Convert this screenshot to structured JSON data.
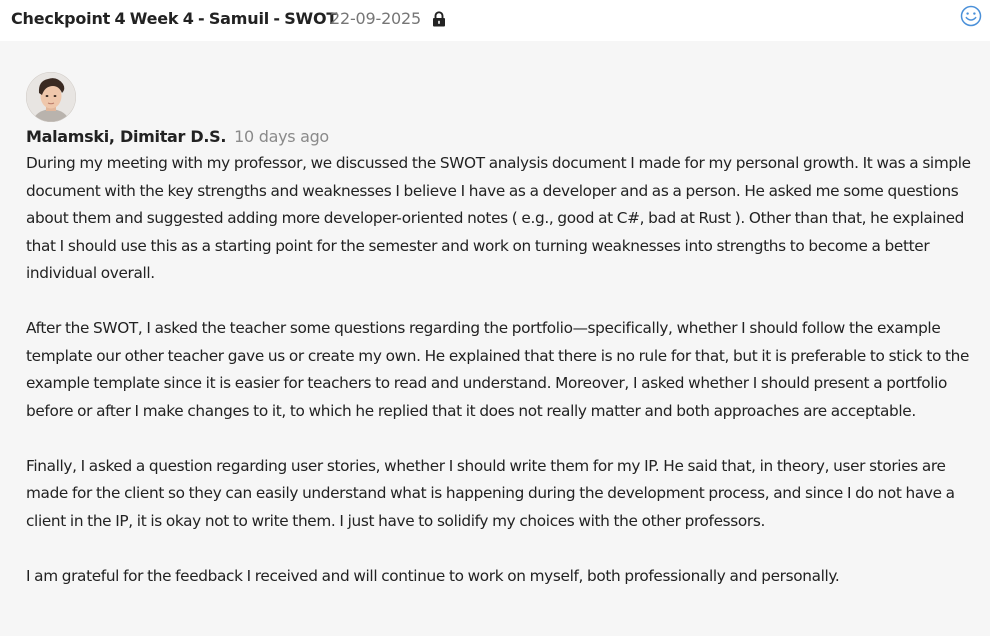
{
  "header": {
    "title": "Checkpoint 4  Week 4 - Samuil - SWOT",
    "date": "22-09-2025",
    "lock_icon": "lock-icon",
    "reaction_icon": "smiley-icon"
  },
  "post": {
    "author": "Malamski, Dimitar D.S.",
    "time_ago": "10 days ago",
    "paragraphs": [
      "During my meeting with my professor, we discussed the SWOT analysis document I made for my personal growth. It was a simple document with the key strengths and weaknesses I believe I have as a developer and as a person. He asked me some questions about them and suggested adding more developer-oriented notes ( e.g., good at C#, bad at Rust ). Other than that, he explained that I should use this as a starting point for the semester and work on turning weaknesses into strengths to become a better individual overall.",
      "After the SWOT, I asked the teacher some questions regarding the portfolio—specifically, whether I should follow the example template our other teacher gave us or create my own. He explained that there is no rule for that, but it is preferable to stick to the example template since it is easier for teachers to read and understand. Moreover, I asked whether I should present a portfolio before or after I make changes to it, to which he replied that it does not really matter and both approaches are acceptable.",
      "Finally, I asked a question regarding user stories, whether I should write them for my IP. He said that, in theory, user stories are made for the client so they can easily understand what is happening during the development process, and since I do not have a client in the IP, it is okay not to write them. I just have to solidify my choices with the other professors.",
      "I am grateful for the feedback I received and will continue to work on myself, both professionally and personally."
    ]
  },
  "colors": {
    "header_bg": "#ffffff",
    "content_bg": "#f6f6f6",
    "text": "#222222",
    "muted": "#8a8a8a",
    "accent": "#4a90d9"
  }
}
